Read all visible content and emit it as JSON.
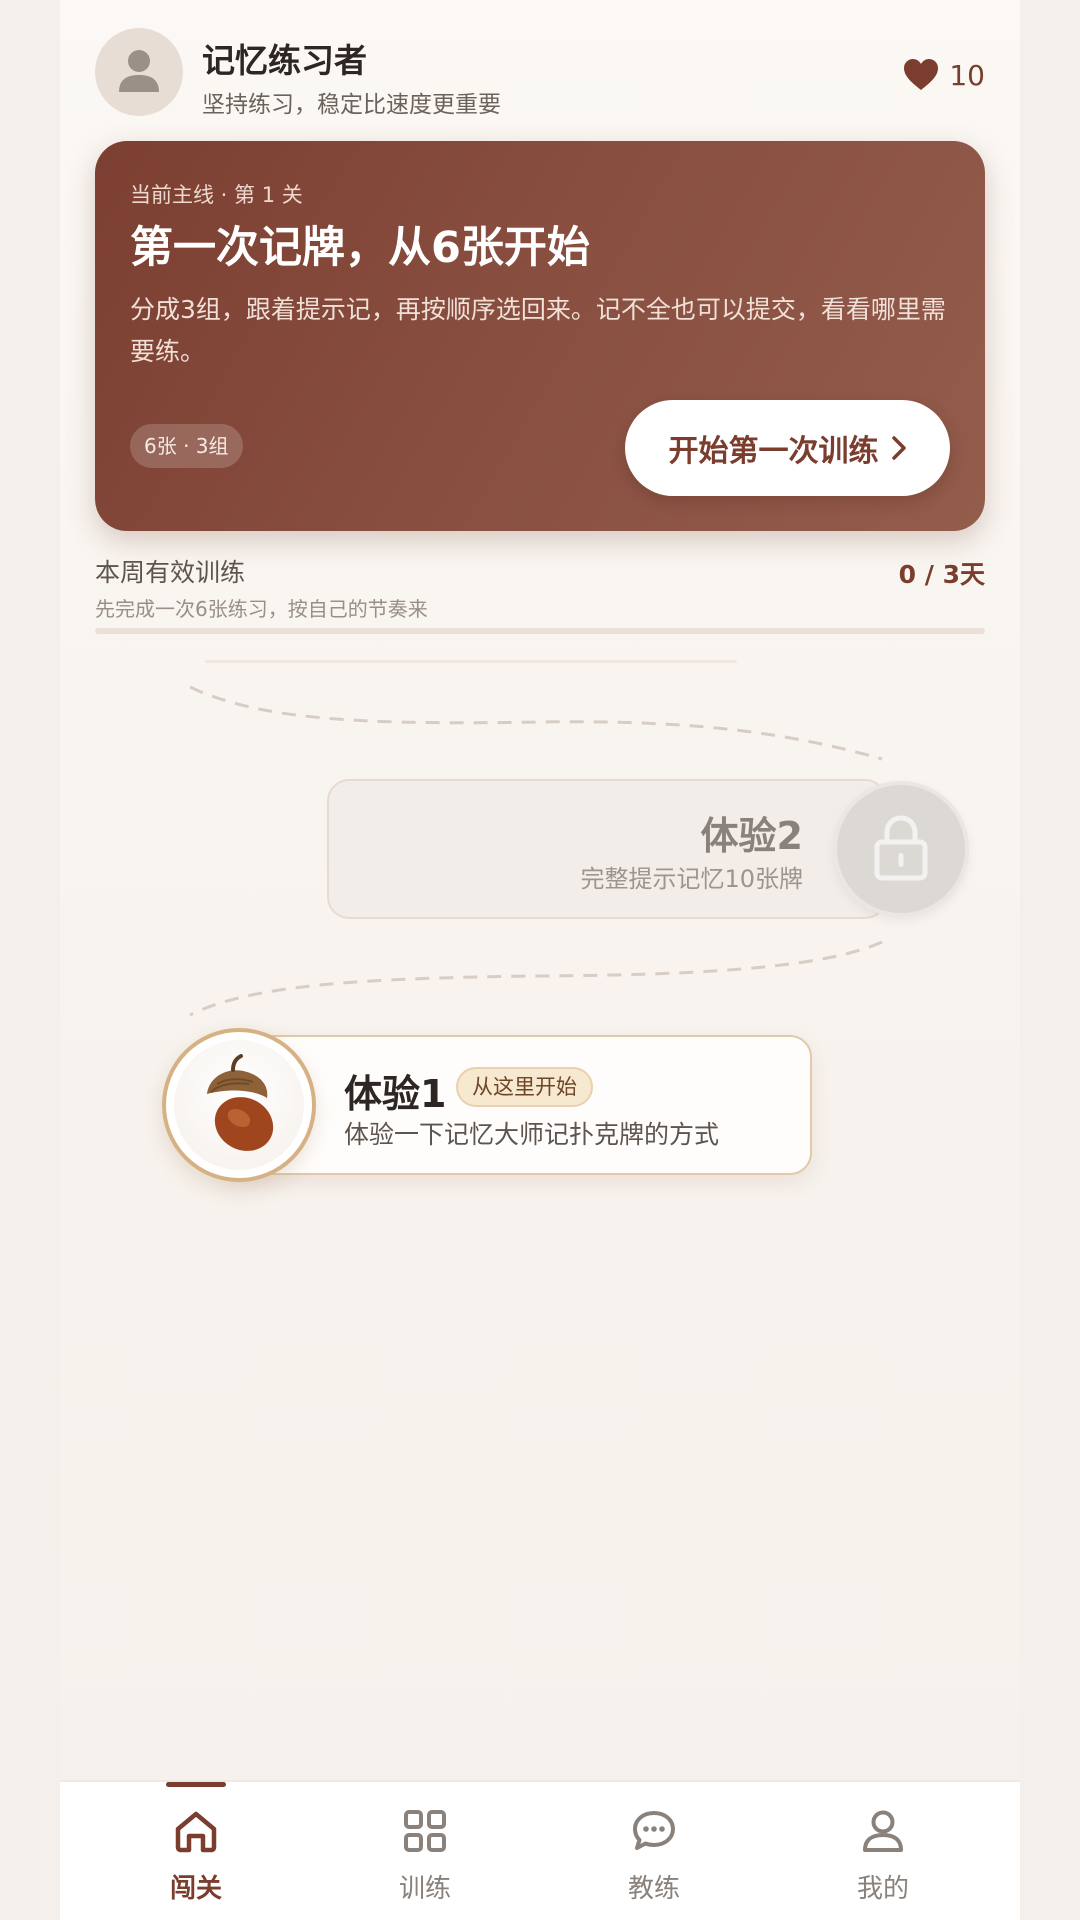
{
  "header": {
    "user_name": "记忆练习者",
    "motto": "坚持练习，稳定比速度更重要",
    "hearts_count": "10",
    "avatar_icon": "user-avatar-icon",
    "heart_icon": "heart-icon"
  },
  "hero": {
    "eyebrow": "当前主线 · 第 1 关",
    "title": "第一次记牌，从6张开始",
    "description": "分成3组，跟着提示记，再按顺序选回来。记不全也可以提交，看看哪里需要练。",
    "tag": "6张 · 3组",
    "button_label": "开始第一次训练",
    "button_icon": "chevron-right-icon"
  },
  "weekly": {
    "label": "本周有效训练",
    "subtitle": "先完成一次6张练习，按自己的节奏来",
    "value": "0 / 3天",
    "progress": 0
  },
  "levels": [
    {
      "title": "体验2",
      "subtitle": "完整提示记忆10张牌",
      "status": "locked",
      "icon": "lock-icon"
    },
    {
      "title": "体验1",
      "badge": "从这里开始",
      "subtitle": "体验一下记忆大师记扑克牌的方式",
      "status": "current",
      "icon": "acorn-icon"
    }
  ],
  "nav": {
    "items": [
      {
        "label": "闯关",
        "icon": "home-icon",
        "active": true
      },
      {
        "label": "训练",
        "icon": "grid-icon",
        "active": false
      },
      {
        "label": "教练",
        "icon": "chat-icon",
        "active": false
      },
      {
        "label": "我的",
        "icon": "profile-icon",
        "active": false
      }
    ]
  },
  "colors": {
    "accent": "#7a3d2e",
    "hero_gradient_start": "#7c3f31",
    "hero_gradient_end": "#935c4b",
    "background": "#f6f1ec",
    "badge_bg": "#f7e8d0",
    "node_border": "#d6b183"
  }
}
